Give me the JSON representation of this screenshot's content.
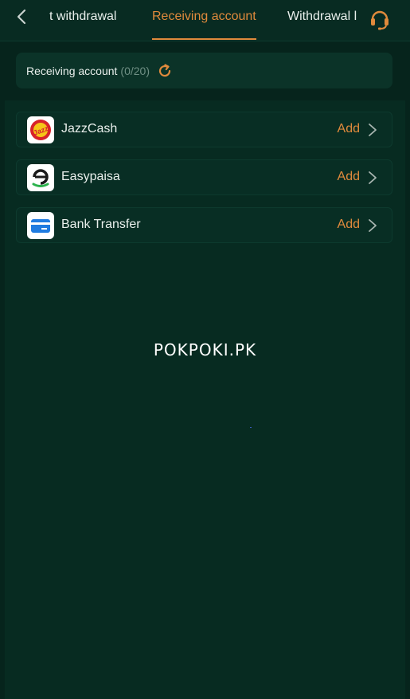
{
  "tabs": [
    {
      "label": "t withdrawal",
      "active": false
    },
    {
      "label": "Receiving account",
      "active": true
    },
    {
      "label": "Withdrawal l",
      "active": false
    }
  ],
  "header": {
    "title": "Receiving account",
    "count": "(0/20)"
  },
  "methods": [
    {
      "name": "JazzCash",
      "action": "Add",
      "icon": "jazzcash-logo"
    },
    {
      "name": "Easypaisa",
      "action": "Add",
      "icon": "easypaisa-logo"
    },
    {
      "name": "Bank Transfer",
      "action": "Add",
      "icon": "bank-card-icon"
    }
  ],
  "watermark": "POKPOKI.PK",
  "colors": {
    "background": "#072b21",
    "accent": "#e08a3c",
    "text": "#e9efec",
    "muted": "#6f8f84"
  }
}
